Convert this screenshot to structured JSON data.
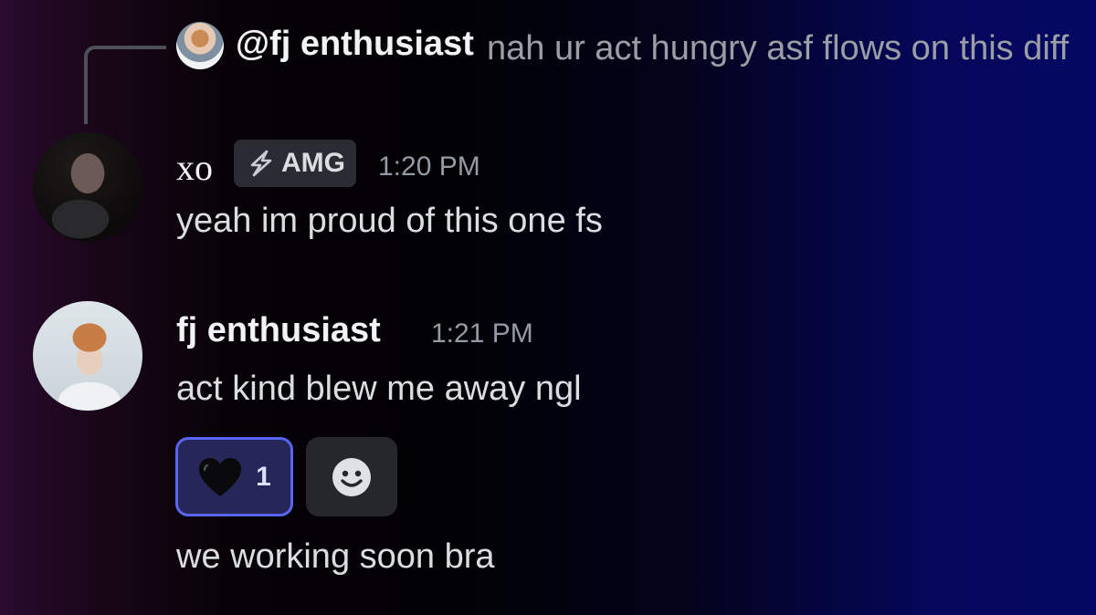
{
  "reply": {
    "mention": "@fj enthusiast",
    "text": "nah ur act hungry asf flows on this diff"
  },
  "messages": [
    {
      "username": "xo",
      "tag": "AMG",
      "timestamp": "1:20 PM",
      "lines": [
        "yeah im proud of this one fs"
      ]
    },
    {
      "username": "fj enthusiast",
      "timestamp": "1:21 PM",
      "lines": [
        "act kind blew me away ngl",
        "we working soon bra"
      ]
    }
  ],
  "reactions": [
    {
      "emoji": "black-heart-icon",
      "count": "1",
      "color": "#5865f2"
    }
  ],
  "icons": {
    "add_reaction": "smile-icon",
    "tag": "lightning-icon"
  }
}
